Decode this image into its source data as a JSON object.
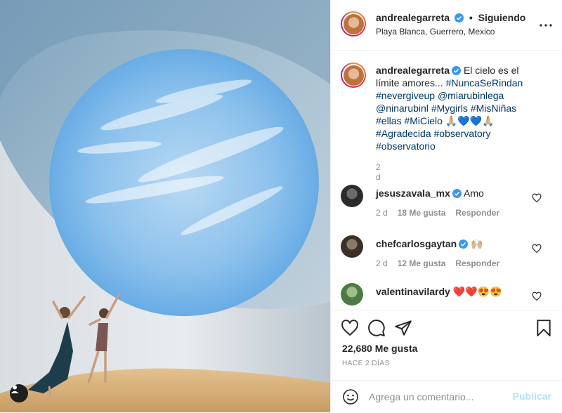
{
  "post": {
    "author": "andrealegarreta",
    "follow_separator": "•",
    "follow_status": "Siguiendo",
    "location": "Playa Blanca, Guerrero, Mexico"
  },
  "caption": {
    "author": "andrealegarreta",
    "text_lead": "El cielo es el límite amores... ",
    "tags": [
      "#NuncaSeRindan",
      "#nevergiveup",
      "@miarubinlega",
      "@ninarubinl",
      "#Mygirls",
      "#MisNiñas",
      "#ellas",
      "#MiCielo"
    ],
    "emoji_line": "🙏🏼💙💙🙏🏼",
    "tags_after": [
      "#Agradecida",
      "#observatory",
      "#observatorio"
    ],
    "time": "2 d"
  },
  "comments": [
    {
      "user": "jesuszavala_mx",
      "text": "Amo",
      "time": "2 d",
      "likes": "18 Me gusta",
      "reply": "Responder"
    },
    {
      "user": "chefcarlosgaytan",
      "text": "🙌🏼",
      "time": "2 d",
      "likes": "12 Me gusta",
      "reply": "Responder"
    },
    {
      "user": "valentinavilardy",
      "text": "❤️❤️😍😍"
    }
  ],
  "engagement": {
    "likes": "22,680 Me gusta",
    "posted": "HACE 2 DÍAS"
  },
  "composer": {
    "placeholder": "Agrega un comentario...",
    "publish_label": "Publicar"
  },
  "icons": {
    "verified": "verified-badge-icon",
    "more": "more-options-icon",
    "like": "heart-icon",
    "comment": "comment-bubble-icon",
    "share": "paper-plane-icon",
    "save": "bookmark-icon",
    "emoji": "emoji-smile-icon",
    "user_tag": "user-tag-icon"
  },
  "colors": {
    "link": "#00376b",
    "verified": "#3897f0",
    "publish_disabled": "#b2dffc",
    "muted": "#8e8e8e"
  }
}
